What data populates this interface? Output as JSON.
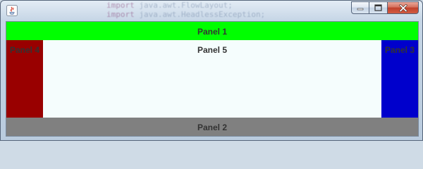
{
  "window": {
    "background_code_lines": [
      {
        "keyword": "import",
        "text": "java.awt.FlowLayout;"
      },
      {
        "keyword": "import",
        "text": "java.awt.HeadlessException;"
      }
    ],
    "controls": {
      "minimize_icon": "minimize-icon",
      "maximize_icon": "maximize-icon",
      "close_icon": "close-icon"
    }
  },
  "panels": {
    "north": {
      "label": "Panel 1",
      "color": "#00ff00"
    },
    "south": {
      "label": "Panel 2",
      "color": "#808080"
    },
    "east": {
      "label": "Panel 3",
      "color": "#0000cc"
    },
    "west": {
      "label": "Panel 4",
      "color": "#990000"
    },
    "center": {
      "label": "Panel 5",
      "color": "#f5fdfd"
    }
  }
}
